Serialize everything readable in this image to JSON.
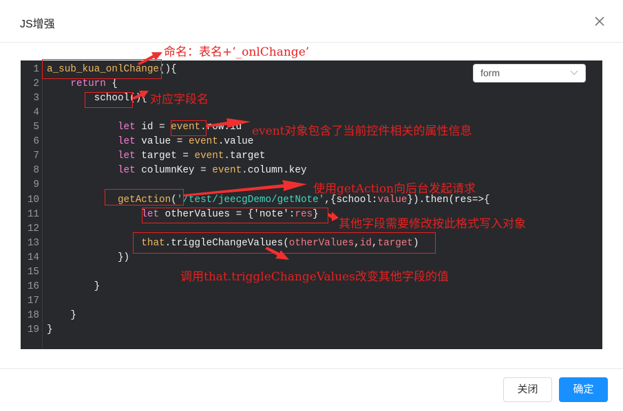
{
  "modal": {
    "title": "JS增强",
    "close_icon": "close-icon"
  },
  "editor": {
    "mode_select": {
      "value": "form"
    },
    "lines": [
      [
        [
          "a_sub_kua_onlChange",
          "fn"
        ],
        [
          "(){",
          "pl"
        ]
      ],
      [
        [
          "    ",
          "pl"
        ],
        [
          "return",
          "kw"
        ],
        [
          " {",
          "pl"
        ]
      ],
      [
        [
          "        school(){",
          "pl"
        ]
      ],
      [
        [
          "",
          "pl"
        ]
      ],
      [
        [
          "            ",
          "pl"
        ],
        [
          "let",
          "kw"
        ],
        [
          " id = ",
          "pl"
        ],
        [
          "event",
          "fn"
        ],
        [
          ".row.id",
          "pl"
        ]
      ],
      [
        [
          "            ",
          "pl"
        ],
        [
          "let",
          "kw"
        ],
        [
          " value = ",
          "pl"
        ],
        [
          "event",
          "fn"
        ],
        [
          ".value",
          "pl"
        ]
      ],
      [
        [
          "            ",
          "pl"
        ],
        [
          "let",
          "kw"
        ],
        [
          " target = ",
          "pl"
        ],
        [
          "event",
          "fn"
        ],
        [
          ".target",
          "pl"
        ]
      ],
      [
        [
          "            ",
          "pl"
        ],
        [
          "let",
          "kw"
        ],
        [
          " columnKey = ",
          "pl"
        ],
        [
          "event",
          "fn"
        ],
        [
          ".column.key",
          "pl"
        ]
      ],
      [
        [
          "",
          "pl"
        ]
      ],
      [
        [
          "            ",
          "pl"
        ],
        [
          "getAction",
          "fn"
        ],
        [
          "(",
          "pl"
        ],
        [
          "'/test/jeecgDemo/getNote'",
          "str"
        ],
        [
          ",{school:",
          "pl"
        ],
        [
          "value",
          "var"
        ],
        [
          "}).then(res=>{",
          "pl"
        ]
      ],
      [
        [
          "                ",
          "pl"
        ],
        [
          "let",
          "kw"
        ],
        [
          " otherValues = {'note':",
          "pl"
        ],
        [
          "res",
          "var"
        ],
        [
          "}",
          "pl"
        ]
      ],
      [
        [
          "",
          "pl"
        ]
      ],
      [
        [
          "                ",
          "pl"
        ],
        [
          "that",
          "fn"
        ],
        [
          ".triggleChangeValues(",
          "pl"
        ],
        [
          "otherValues",
          "var"
        ],
        [
          ",",
          "pl"
        ],
        [
          "id",
          "var"
        ],
        [
          ",",
          "pl"
        ],
        [
          "target",
          "var"
        ],
        [
          ")",
          "pl"
        ]
      ],
      [
        [
          "            })",
          "pl"
        ]
      ],
      [
        [
          "",
          "pl"
        ]
      ],
      [
        [
          "        }",
          "pl"
        ]
      ],
      [
        [
          "",
          "pl"
        ]
      ],
      [
        [
          "    }",
          "pl"
        ]
      ],
      [
        [
          "}",
          "pl"
        ]
      ]
    ]
  },
  "annotations": {
    "naming": "命名：表名+’_onlChange’",
    "field": "对应字段名",
    "event": "event对象包含了当前控件相关的属性信息",
    "request": "使用getAction向后台发起请求",
    "format": "其他字段需要修改按此格式写入对象",
    "call": "调用that.triggleChangeValues改变其他字段的值"
  },
  "footer": {
    "cancel_label": "关闭",
    "ok_label": "确定"
  },
  "colors": {
    "primary": "#1890ff",
    "annotation": "#e82020",
    "editor_bg": "#28292c"
  }
}
